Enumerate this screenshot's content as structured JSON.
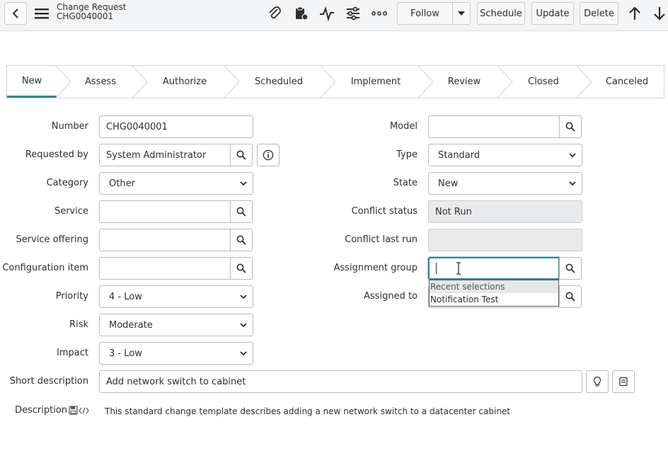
{
  "header": {
    "record_type": "Change Request",
    "record_number": "CHG0040001",
    "icons": [
      "back-icon",
      "menu-icon",
      "attachment-icon",
      "clipboard-icon",
      "activity-icon",
      "settings-sliders-icon",
      "more-icon",
      "arrow-up-icon",
      "arrow-down-icon"
    ],
    "follow_label": "Follow",
    "schedule_label": "Schedule",
    "update_label": "Update",
    "delete_label": "Delete"
  },
  "stages": [
    {
      "label": "New",
      "active": true
    },
    {
      "label": "Assess"
    },
    {
      "label": "Authorize"
    },
    {
      "label": "Scheduled"
    },
    {
      "label": "Implement"
    },
    {
      "label": "Review"
    },
    {
      "label": "Closed"
    },
    {
      "label": "Canceled"
    }
  ],
  "form": {
    "number": {
      "label": "Number",
      "value": "CHG0040001"
    },
    "requested_by": {
      "label": "Requested by",
      "value": "System Administrator"
    },
    "category": {
      "label": "Category",
      "value": "Other"
    },
    "service": {
      "label": "Service",
      "value": ""
    },
    "service_offering": {
      "label": "Service offering",
      "value": ""
    },
    "configuration_item": {
      "label": "Configuration item",
      "value": ""
    },
    "priority": {
      "label": "Priority",
      "value": "4 - Low"
    },
    "risk": {
      "label": "Risk",
      "value": "Moderate"
    },
    "impact": {
      "label": "Impact",
      "value": "3 - Low"
    },
    "model": {
      "label": "Model",
      "value": ""
    },
    "type": {
      "label": "Type",
      "value": "Standard"
    },
    "state": {
      "label": "State",
      "value": "New"
    },
    "conflict_status": {
      "label": "Conflict status",
      "value": "Not Run"
    },
    "conflict_last_run": {
      "label": "Conflict last run",
      "value": ""
    },
    "assignment_group": {
      "label": "Assignment group",
      "value": ""
    },
    "assigned_to": {
      "label": "Assigned to",
      "value": ""
    },
    "short_description": {
      "label": "Short description",
      "value": "Add network switch to cabinet"
    },
    "description": {
      "label": "Description",
      "value": "This standard change template describes adding a new network switch to a datacenter cabinet"
    }
  },
  "autocomplete": {
    "header": "Recent selections",
    "options": [
      "Notification Test"
    ]
  },
  "colors": {
    "accent": "#2b8a8d",
    "header_bg": "#f3f4f5",
    "readonly_bg": "#e9eaeb"
  }
}
